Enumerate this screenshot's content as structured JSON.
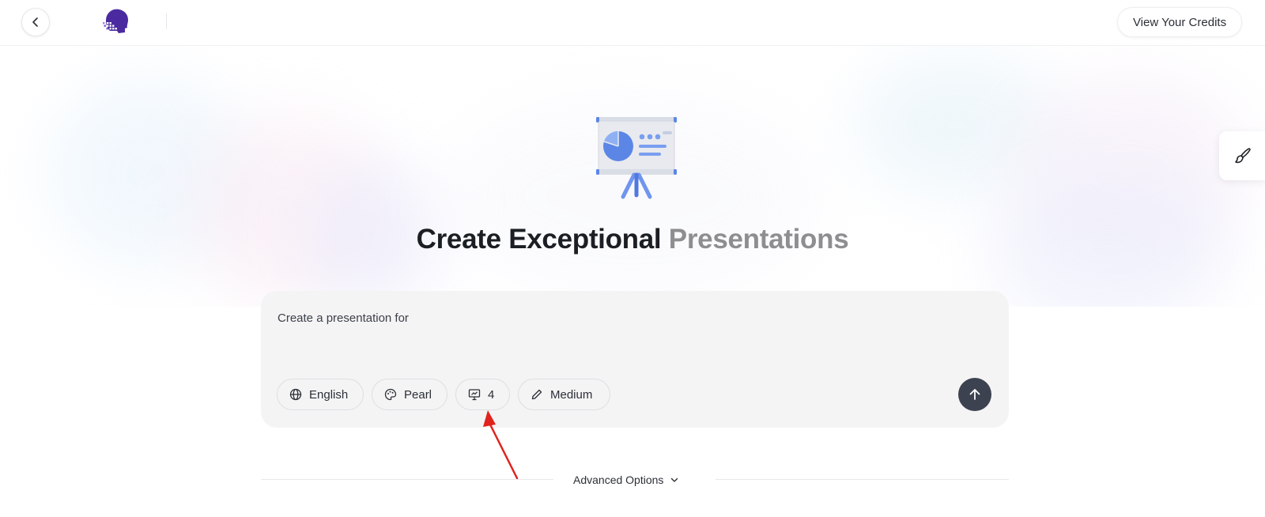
{
  "header": {
    "back_icon": "chevron-left-icon",
    "logo": "purple-head-logo",
    "credits_label": "View Your Credits"
  },
  "side_tool": {
    "icon": "paintbrush-icon"
  },
  "hero": {
    "illustration": "presentation-board-icon",
    "title_dark": "Create Exceptional",
    "title_muted": "Presentations"
  },
  "prompt": {
    "placeholder": "Create a presentation for",
    "value": ""
  },
  "options": {
    "language": {
      "icon": "globe-icon",
      "label": "English"
    },
    "theme": {
      "icon": "palette-icon",
      "label": "Pearl"
    },
    "slides": {
      "icon": "slide-icon",
      "label": "4"
    },
    "length": {
      "icon": "pencil-icon",
      "label": "Medium"
    }
  },
  "send": {
    "icon": "arrow-up-icon"
  },
  "advanced": {
    "label": "Advanced Options",
    "icon": "chevron-down-icon"
  },
  "colors": {
    "title_dark": "#1b1e23",
    "title_muted": "#8e8e90",
    "card_bg": "#f4f4f5",
    "send_bg": "#3d4250",
    "logo_purple": "#4b2aa0",
    "annotation_red": "#e0231c"
  }
}
